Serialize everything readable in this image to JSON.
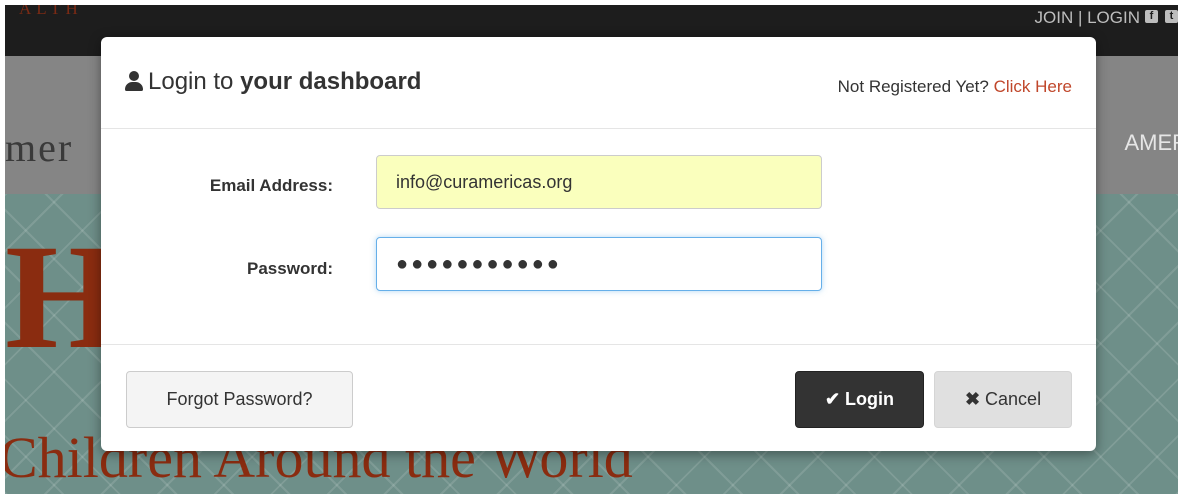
{
  "background": {
    "brand_fragment": "ALTH",
    "top_links": "JOIN | LOGIN",
    "social_icons": [
      "facebook-icon",
      "twitter-icon"
    ],
    "nav_logo_fragment": "mer",
    "nav_item_fragment": "AMER",
    "hero_letter": "H",
    "hero_subtitle": "Children Around the World"
  },
  "modal": {
    "title_regular": "Login to ",
    "title_bold": "your dashboard",
    "not_registered": "Not Registered Yet? ",
    "click_here": "Click Here",
    "email_label": "Email Address:",
    "email_value": "info@curamericas.org",
    "password_label": "Password:",
    "password_mask": "●●●●●●●●●●●",
    "forgot_button": "Forgot Password?",
    "login_button": "Login",
    "cancel_button": "Cancel"
  },
  "colors": {
    "link": "#c0472b",
    "autofill": "#faffbd",
    "login_bg": "#333333",
    "focus": "#66afe9"
  }
}
